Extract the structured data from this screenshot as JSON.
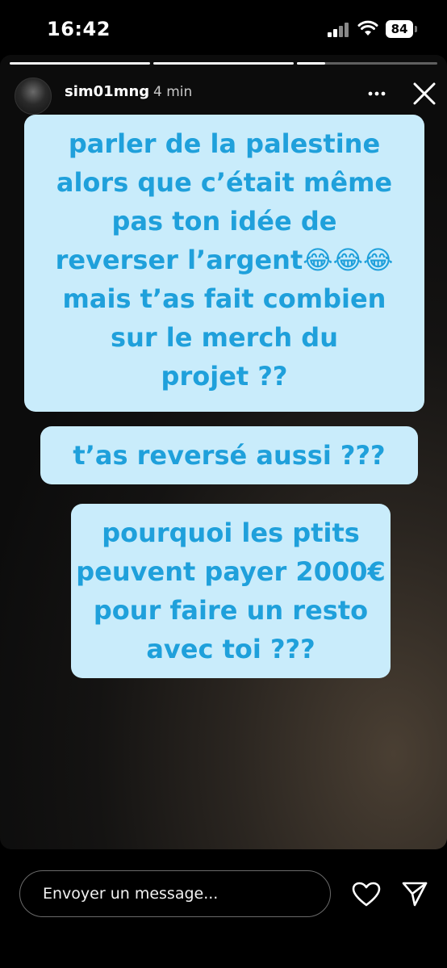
{
  "status_bar": {
    "time": "16:42",
    "battery": "84"
  },
  "story": {
    "username": "sim01mng",
    "time_ago": "4 min",
    "progress": [
      1,
      1,
      0.2
    ],
    "bubbles": [
      [
        "parler de la palestine",
        "alors que c’était même",
        "pas ton idée de",
        "reverser l’argent😂😂😂",
        "mais t’as fait combien",
        "sur le merch du",
        "projet ??"
      ],
      [
        "t’as reversé aussi ???"
      ],
      [
        "pourquoi les ptits",
        "peuvent payer 2000€",
        "pour faire un resto",
        "avec toi ???"
      ]
    ]
  },
  "reply": {
    "placeholder": "Envoyer un message..."
  },
  "icons": {
    "more": "more-horizontal-icon",
    "close": "close-icon",
    "like": "heart-icon",
    "send": "send-icon"
  },
  "colors": {
    "bubble_bg": "#c9ecfb",
    "bubble_text": "#1fa0db"
  }
}
